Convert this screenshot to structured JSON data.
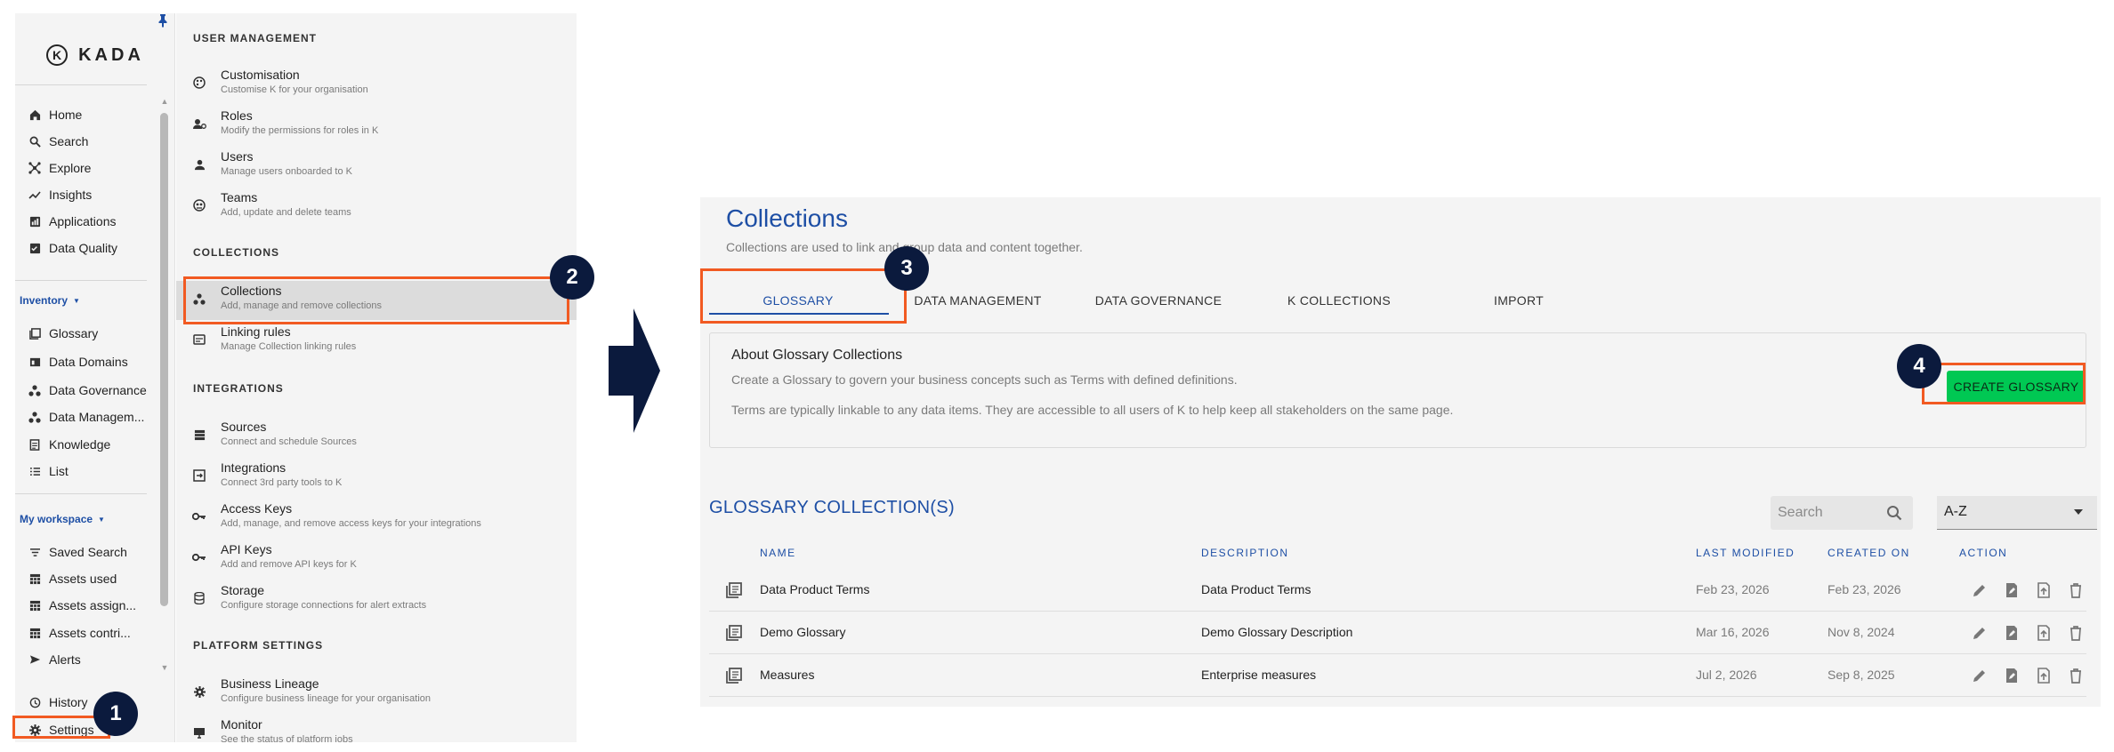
{
  "nav": {
    "logo_mark": "K",
    "logo_text": "KADA",
    "items_top": [
      {
        "label": "Home",
        "icon": "home-icon"
      },
      {
        "label": "Search",
        "icon": "search-icon"
      },
      {
        "label": "Explore",
        "icon": "explore-icon"
      },
      {
        "label": "Insights",
        "icon": "insights-icon"
      },
      {
        "label": "Applications",
        "icon": "applications-icon"
      },
      {
        "label": "Data Quality",
        "icon": "data-quality-icon"
      }
    ],
    "inventory_label": "Inventory",
    "items_inventory": [
      {
        "label": "Glossary",
        "icon": "glossary-icon"
      },
      {
        "label": "Data Domains",
        "icon": "data-domains-icon"
      },
      {
        "label": "Data Governance",
        "icon": "data-governance-icon"
      },
      {
        "label": "Data Managem...",
        "icon": "data-management-icon"
      },
      {
        "label": "Knowledge",
        "icon": "knowledge-icon"
      },
      {
        "label": "List",
        "icon": "list-icon"
      }
    ],
    "workspace_label": "My workspace",
    "items_workspace": [
      {
        "label": "Saved Search",
        "icon": "saved-search-icon"
      },
      {
        "label": "Assets used",
        "icon": "assets-used-icon"
      },
      {
        "label": "Assets assign...",
        "icon": "assets-assigned-icon"
      },
      {
        "label": "Assets contri...",
        "icon": "assets-contributed-icon"
      },
      {
        "label": "Alerts",
        "icon": "alerts-icon"
      }
    ],
    "items_bottom": [
      {
        "label": "History",
        "icon": "history-icon"
      },
      {
        "label": "Settings",
        "icon": "gear-icon"
      }
    ]
  },
  "settings": {
    "user_management": {
      "heading": "USER MANAGEMENT",
      "items": [
        {
          "title": "Customisation",
          "sub": "Customise K for your organisation"
        },
        {
          "title": "Roles",
          "sub": "Modify the permissions for roles in K"
        },
        {
          "title": "Users",
          "sub": "Manage users onboarded to K"
        },
        {
          "title": "Teams",
          "sub": "Add, update and delete teams"
        }
      ]
    },
    "collections": {
      "heading": "COLLECTIONS",
      "items": [
        {
          "title": "Collections",
          "sub": "Add, manage and remove collections"
        },
        {
          "title": "Linking rules",
          "sub": "Manage Collection linking rules"
        }
      ]
    },
    "integrations": {
      "heading": "INTEGRATIONS",
      "items": [
        {
          "title": "Sources",
          "sub": "Connect and schedule Sources"
        },
        {
          "title": "Integrations",
          "sub": "Connect 3rd party tools to K"
        },
        {
          "title": "Access Keys",
          "sub": "Add, manage, and remove access keys for your integrations"
        },
        {
          "title": "API Keys",
          "sub": "Add and remove API keys for K"
        },
        {
          "title": "Storage",
          "sub": "Configure storage connections for alert extracts"
        }
      ]
    },
    "platform": {
      "heading": "PLATFORM SETTINGS",
      "items": [
        {
          "title": "Business Lineage",
          "sub": "Configure business lineage for your organisation"
        },
        {
          "title": "Monitor",
          "sub": "See the status of platform jobs"
        }
      ]
    }
  },
  "collections_page": {
    "title": "Collections",
    "subtitle": "Collections are used to link and group data and content together.",
    "tabs": [
      "GLOSSARY",
      "DATA MANAGEMENT",
      "DATA GOVERNANCE",
      "K COLLECTIONS",
      "IMPORT"
    ],
    "about": {
      "heading": "About Glossary Collections",
      "line1": "Create a Glossary to govern your business concepts such as Terms with defined definitions.",
      "line2": "Terms are typically linkable to any data items. They are accessible to all users of K to help keep all stakeholders on the same page.",
      "button": "CREATE GLOSSARY"
    },
    "list_title": "GLOSSARY COLLECTION(S)",
    "search_placeholder": "Search",
    "sort_value": "A-Z",
    "columns": {
      "name": "NAME",
      "description": "DESCRIPTION",
      "last_modified": "LAST MODIFIED",
      "created_on": "CREATED ON",
      "action": "ACTION"
    },
    "rows": [
      {
        "name": "Data Product Terms",
        "description": "Data Product Terms",
        "last_modified": "Feb 23, 2026",
        "created_on": "Feb 23, 2026"
      },
      {
        "name": "Demo Glossary",
        "description": "Demo Glossary Description",
        "last_modified": "Mar 16, 2026",
        "created_on": "Nov 8, 2024"
      },
      {
        "name": "Measures",
        "description": "Enterprise measures",
        "last_modified": "Jul 2, 2026",
        "created_on": "Sep 8, 2025"
      }
    ]
  },
  "steps": [
    "1",
    "2",
    "3",
    "4"
  ],
  "colors": {
    "accent": "#1e4fa5",
    "highlight": "#f15a22",
    "badge": "#0b1a3d",
    "create_button": "#00c853"
  }
}
